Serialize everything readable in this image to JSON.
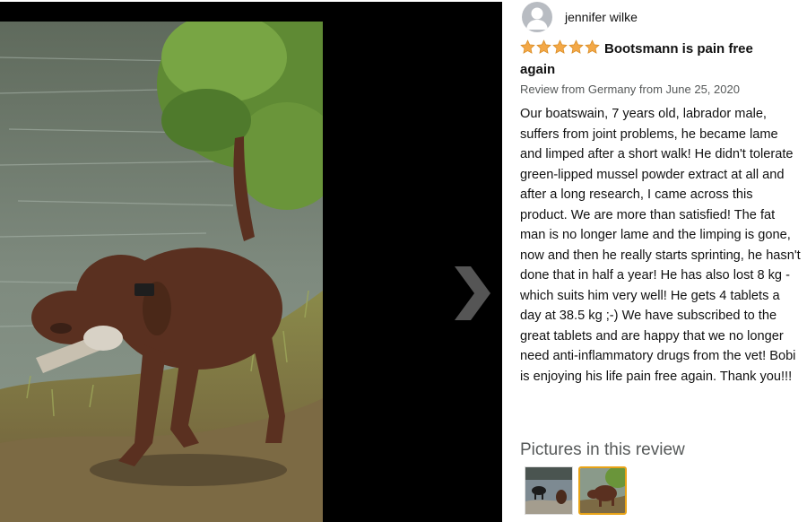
{
  "reviewer": {
    "name": "jennifer wilke",
    "avatar_icon": "user-silhouette-icon"
  },
  "review": {
    "rating": 5,
    "rating_max": 5,
    "star_color": "#f3a847",
    "title": "Bootsmann is pain free again",
    "meta": "Review from Germany from June 25, 2020",
    "body": "Our boatswain, 7 years old, labrador male, suffers from joint problems, he became lame and limped after a short walk! He didn't tolerate green-lipped mussel powder extract at all and after a long research, I came across this product. We are more than satisfied! The fat man is no longer lame and the limping is gone, now and then he really starts sprinting, he hasn't done that in half a year! He has also lost 8 kg - which suits him very well! He gets 4 tablets a day at 38.5 kg ;-) We have subscribed to the great tablets and are happy that we no longer need anti-inflammatory drugs from the vet! Bobi is enjoying his life pain free again. Thank you!!!"
  },
  "pictures": {
    "heading": "Pictures in this review",
    "selected_index": 1,
    "selected_border_color": "#e8a317"
  },
  "viewer": {
    "next_icon": "chevron-right-icon"
  }
}
